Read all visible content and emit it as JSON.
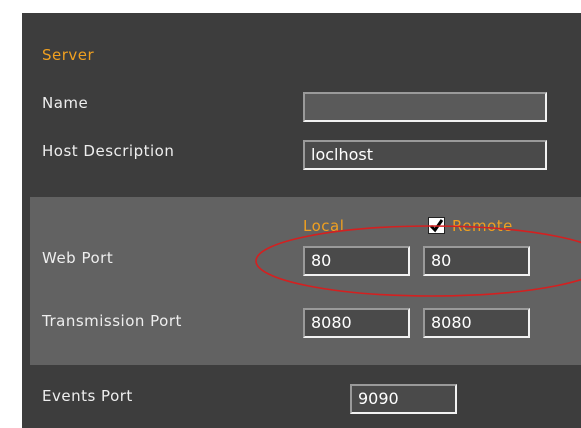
{
  "server": {
    "section_title": "Server",
    "name_label": "Name",
    "name_value": "",
    "host_label": "Host Description",
    "host_value": "loclhost"
  },
  "ports": {
    "local_header": "Local",
    "remote_header": "Remote",
    "remote_checked": true,
    "web_port_label": "Web Port",
    "web_port_local": "80",
    "web_port_remote": "80",
    "transmission_port_label": "Transmission Port",
    "transmission_port_local": "8080",
    "transmission_port_remote": "8080"
  },
  "events": {
    "label": "Events Port",
    "value": "9090"
  },
  "colors": {
    "panel": "#3d3d3d",
    "group": "#626262",
    "accent_orange": "#f0a020",
    "annotation_red": "#d42020"
  }
}
